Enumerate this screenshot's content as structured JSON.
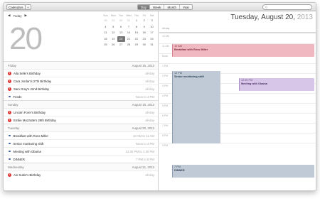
{
  "toolbar": {
    "calendars_label": "Calendars",
    "add_label": "+",
    "views": [
      {
        "label": "Day",
        "active": true
      },
      {
        "label": "Week",
        "active": false
      },
      {
        "label": "Month",
        "active": false
      },
      {
        "label": "Year",
        "active": false
      }
    ],
    "search_placeholder": "Q"
  },
  "nav": {
    "prev": "◀",
    "today": "Today",
    "next": "▶"
  },
  "big_day": "20",
  "mini_calendar": {
    "weekdays": [
      "Sun",
      "Mon",
      "Tue",
      "Wed",
      "Thu",
      "Fri",
      "Sat"
    ],
    "weeks": [
      [
        "28",
        "29",
        "30",
        "31",
        "1",
        "2",
        "3"
      ],
      [
        "4",
        "5",
        "6",
        "7",
        "8",
        "9",
        "10"
      ],
      [
        "11",
        "12",
        "13",
        "14",
        "15",
        "16",
        "17"
      ],
      [
        "18",
        "19",
        "20",
        "21",
        "22",
        "23",
        "24"
      ],
      [
        "25",
        "26",
        "27",
        "28",
        "29",
        "30",
        "31"
      ]
    ],
    "selected": "20"
  },
  "list": [
    {
      "type": "section",
      "day": "Friday",
      "date": "August 16, 2013"
    },
    {
      "type": "event",
      "icon": "birthday",
      "name": "Aila Selle's Birthday",
      "time": "all-day"
    },
    {
      "type": "event",
      "icon": "birthday",
      "name": "Cara Jordan's 27th Birthday",
      "time": "all-day"
    },
    {
      "type": "event",
      "icon": "birthday",
      "name": "Sam Gray's 22nd Birthday",
      "time": "all-day"
    },
    {
      "type": "event",
      "icon": "dot",
      "name": "Feeds",
      "time": "Noon to 4 PM"
    },
    {
      "type": "section",
      "day": "Sunday",
      "date": "August 18, 2013"
    },
    {
      "type": "event",
      "icon": "birthday",
      "name": "Lincoln Forer's Birthday",
      "time": "all-day"
    },
    {
      "type": "event",
      "icon": "birthday",
      "name": "Emilie Mozzatte's 29th Birthday",
      "time": "all-day"
    },
    {
      "type": "section",
      "day": "Tuesday",
      "date": "August 20, 2013"
    },
    {
      "type": "event",
      "icon": "dot",
      "name": "Breakfast with Ross Miller",
      "time": "10 AM to 11 AM"
    },
    {
      "type": "event",
      "icon": "dot",
      "name": "Senior monitoring shift",
      "time": "Noon to 4 PM"
    },
    {
      "type": "event",
      "icon": "dot",
      "name": "Meeting with Obama",
      "time": "12:30 PM to 1:30 PM"
    },
    {
      "type": "event",
      "icon": "dot",
      "name": "DINNER",
      "time": "7 PM to 8 PM"
    },
    {
      "type": "section",
      "day": "Wednesday",
      "date": "August 21, 2013"
    },
    {
      "type": "event",
      "icon": "birthday",
      "name": "Ain Subin's Birthday",
      "time": "all-day"
    }
  ],
  "day_view": {
    "title_weekday": "Tuesday,",
    "title_date": "August 20,",
    "title_year": "2013",
    "allday_label": "all-day",
    "hours": [
      "10 AM",
      "11 AM",
      "Noon",
      "1 PM",
      "2 PM",
      "3 PM",
      "4 PM",
      "5 PM",
      "6 PM",
      "7 PM",
      "8 PM",
      "9 PM"
    ],
    "events": [
      {
        "time": "10 AM",
        "name": "Breakfast with Ross Miller",
        "color": "#f0b8c0"
      },
      {
        "time": "12 PM",
        "name": "Senior monitoring shift",
        "color": "#bfcad6"
      },
      {
        "time": "12:30 PM",
        "name": "Meeting with Obama",
        "color": "#d8c6e8"
      },
      {
        "time": "7 PM",
        "name": "DINNER",
        "color": "#bfcad6"
      }
    ]
  }
}
